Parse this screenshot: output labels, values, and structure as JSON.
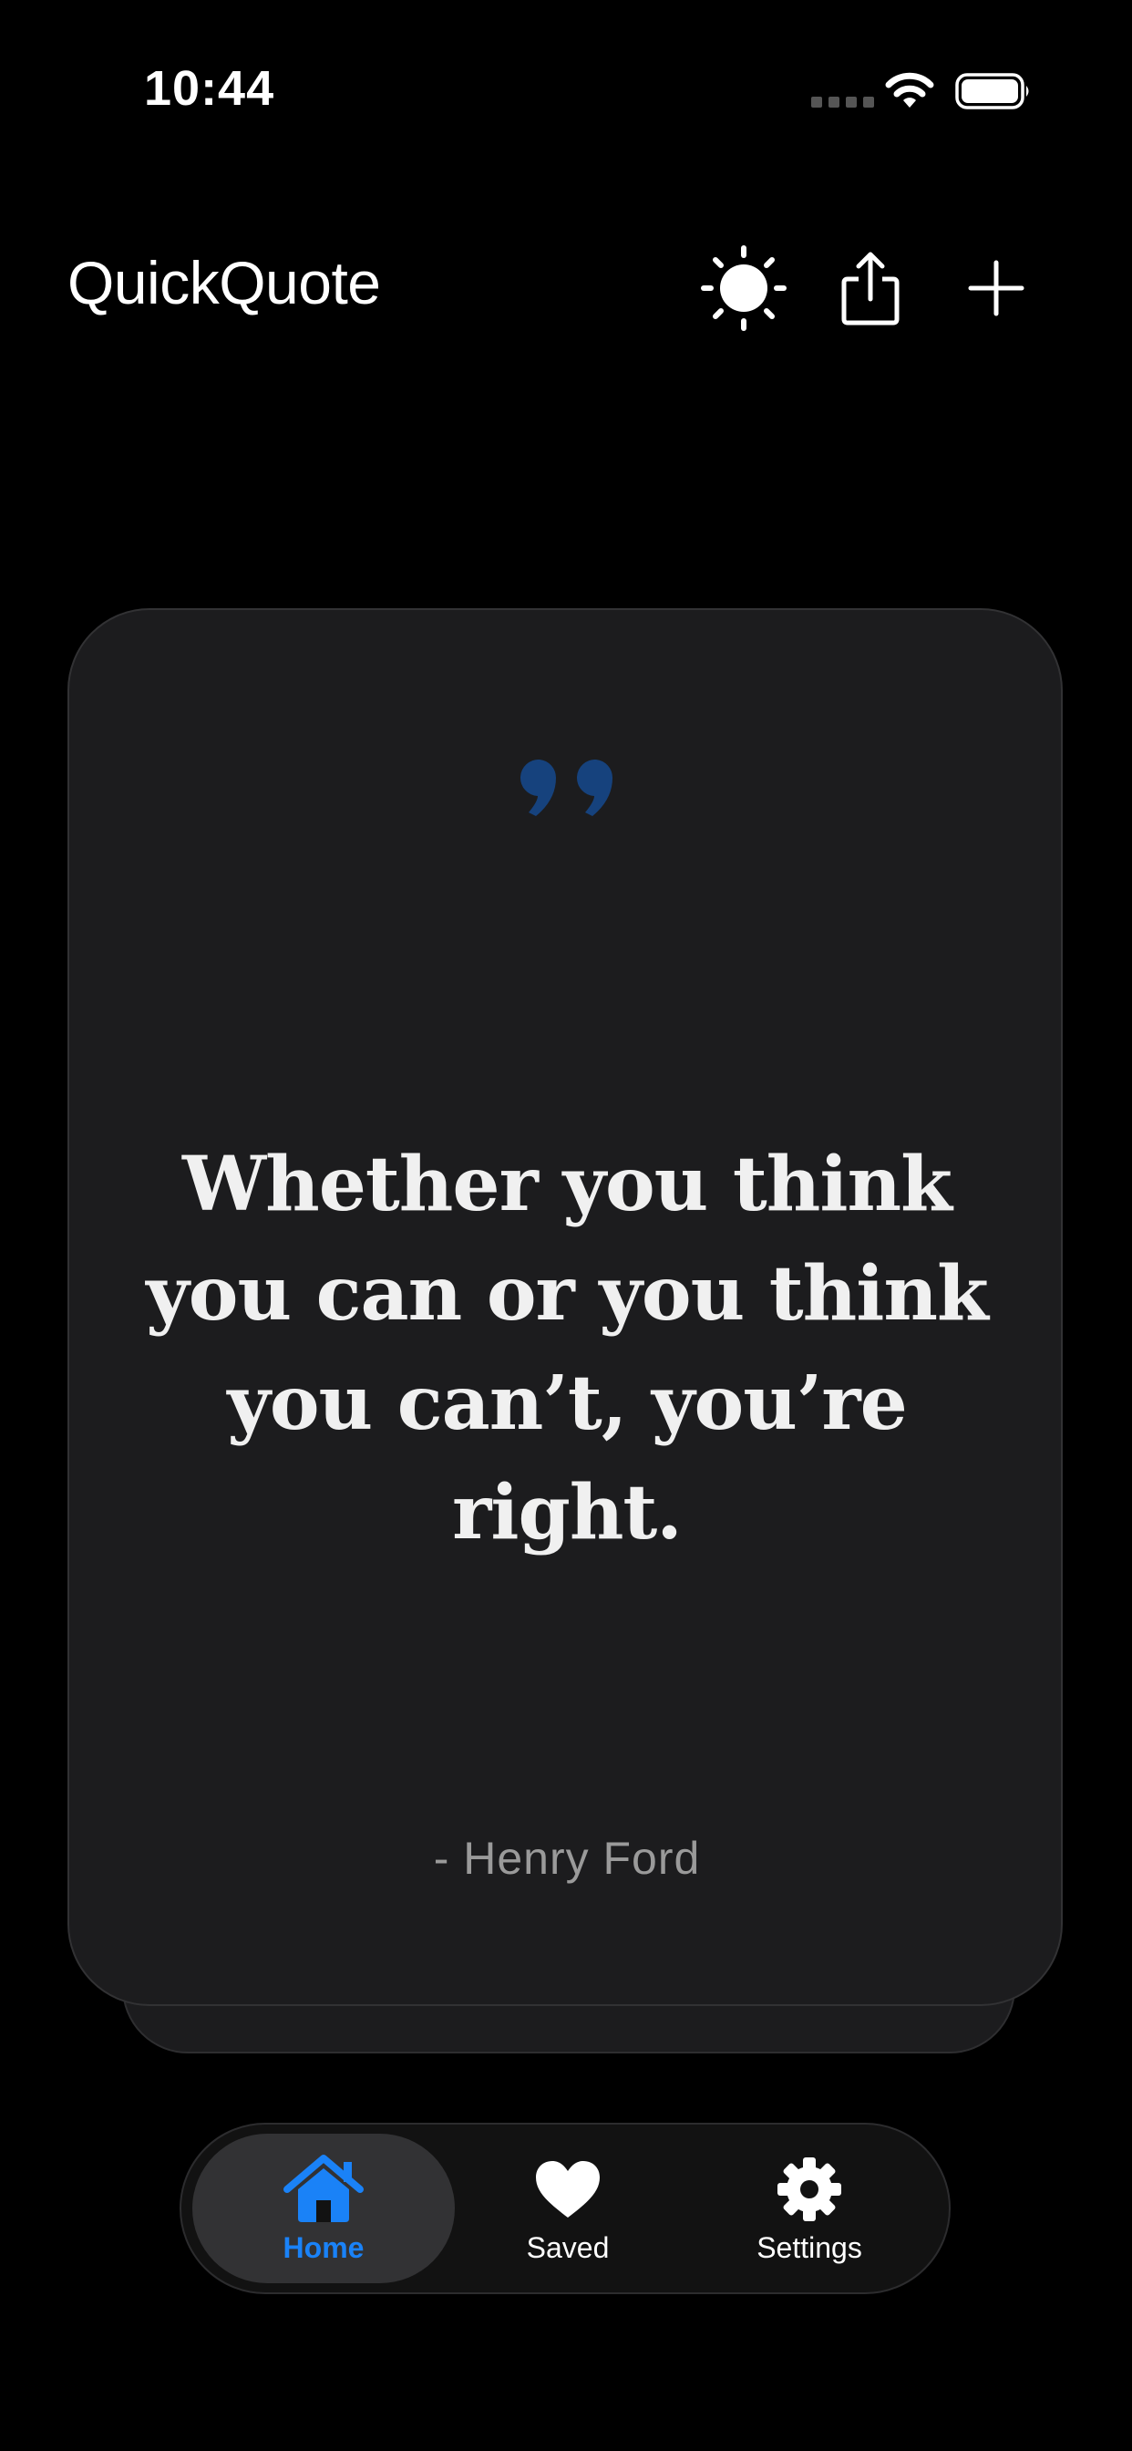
{
  "status": {
    "time": "10:44"
  },
  "header": {
    "title": "QuickQuote",
    "actions": [
      "sun-icon",
      "share-icon",
      "plus-icon"
    ]
  },
  "quote": {
    "text": "Whether you think you can or you think you can’t, you’re right.",
    "author": "- Henry Ford",
    "accent_color": "#16427d"
  },
  "tabbar": {
    "tabs": [
      {
        "label": "Home",
        "icon": "home-icon",
        "selected": true
      },
      {
        "label": "Saved",
        "icon": "heart-icon",
        "selected": false
      },
      {
        "label": "Settings",
        "icon": "gear-icon",
        "selected": false
      }
    ],
    "active_color": "#1a82f7"
  }
}
